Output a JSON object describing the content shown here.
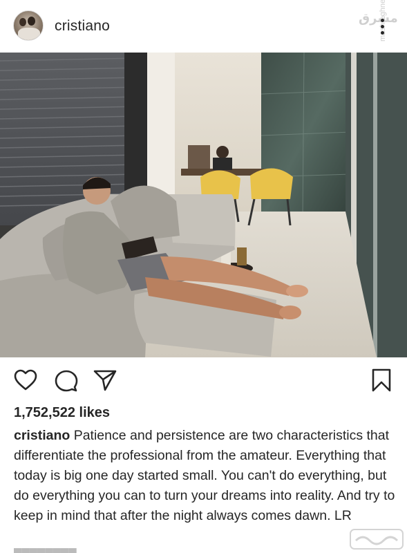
{
  "post": {
    "username": "cristiano",
    "likes": "1,752,522 likes",
    "caption_user": "cristiano",
    "caption_text": "Patience and persistence are two characteristics that differentiate the professional from the amateur. Everything that today is big one day started small. You can't do everything, but do everything you can to turn your dreams into reality. And try to keep in mind that after the night always comes dawn. LR"
  },
  "watermark": {
    "side_text": "mashreghnews.ir"
  },
  "icons": {
    "like": "heart-icon",
    "comment": "comment-icon",
    "share": "send-icon",
    "save": "bookmark-icon",
    "more": "more-vertical-icon"
  },
  "colors": {
    "text": "#262626",
    "watermark": "#cfcfcf"
  }
}
